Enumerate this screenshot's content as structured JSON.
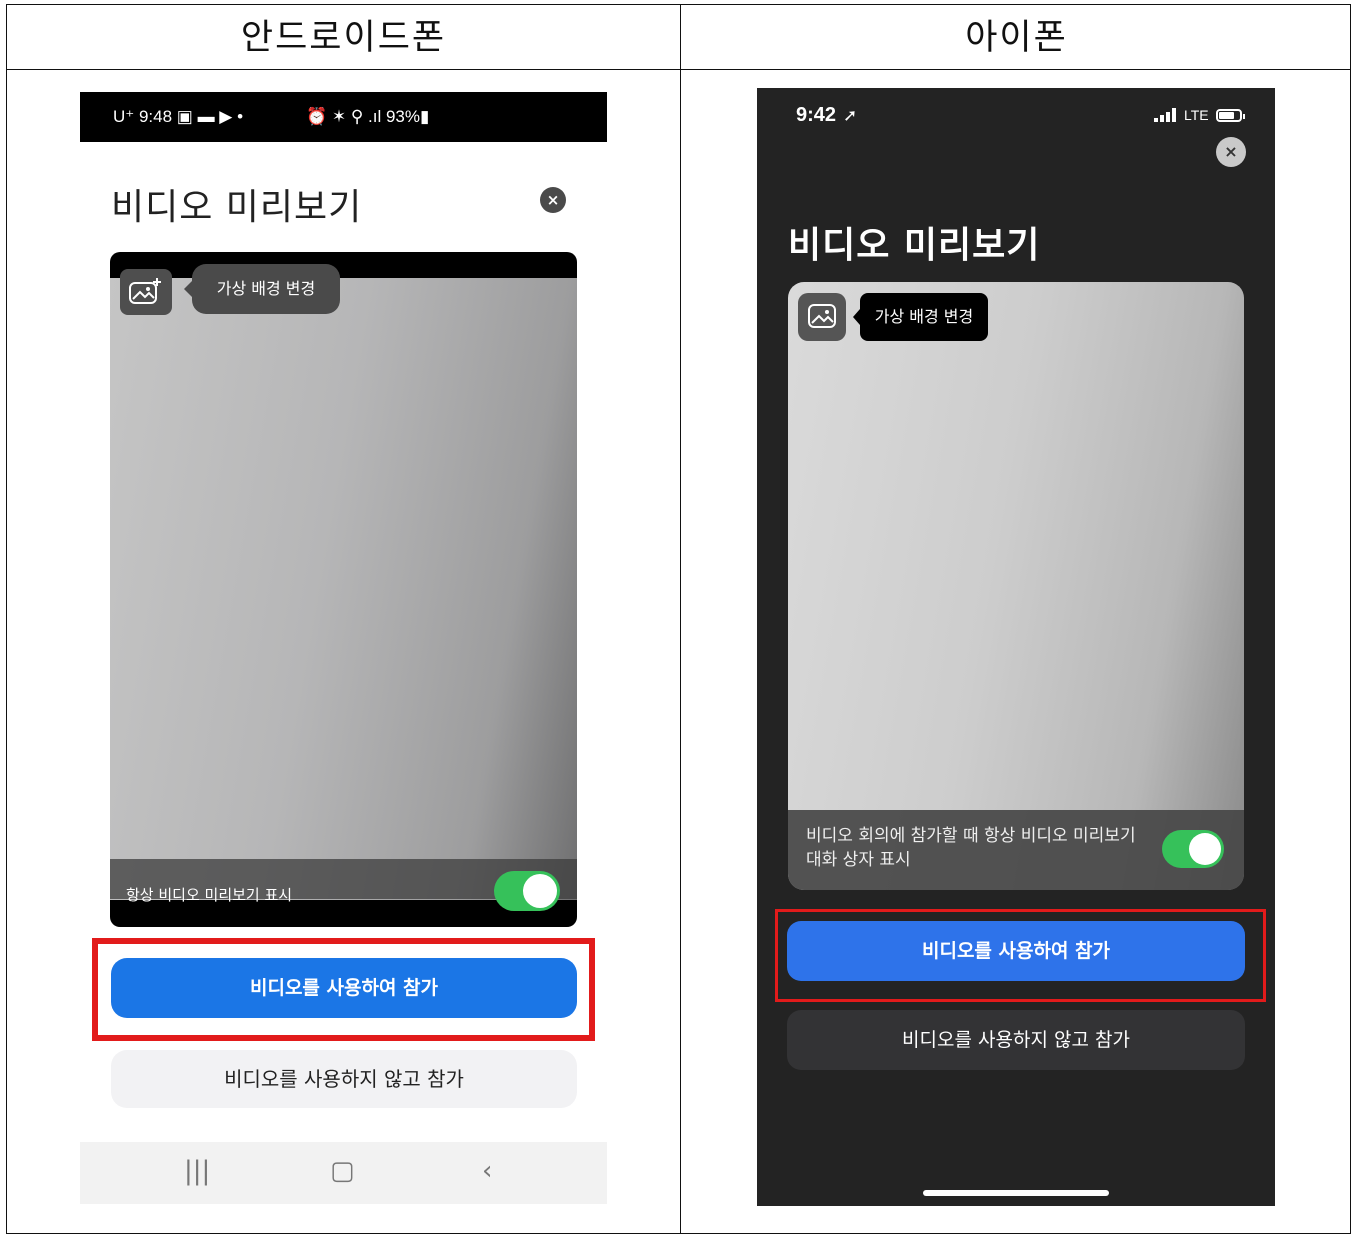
{
  "table": {
    "header_left": "안드로이드폰",
    "header_right": "아이폰"
  },
  "android": {
    "status_left": "U⁺ 9:48 ▣ ▬ ▶ •",
    "status_right": "⏰ ✶ ⚲ .ıl 93%▮",
    "title": "비디오 미리보기",
    "close_icon": "×",
    "virtual_bg_tooltip": "가상 배경 변경",
    "always_show_label": "항상 비디오 미리보기 표시",
    "toggle_on": true,
    "join_with_video": "비디오를 사용하여 참가",
    "join_without_video": "비디오를 사용하지 않고 참가",
    "nav_recent": "|||",
    "nav_home": "▢",
    "nav_back": "‹",
    "accent_color": "#1b76e6",
    "highlight_color": "#e21b1b"
  },
  "iphone": {
    "time": "9:42",
    "location_icon": "➚",
    "network": "LTE",
    "close_icon": "×",
    "title": "비디오 미리보기",
    "virtual_bg_tooltip": "가상 배경 변경",
    "always_show_label": "비디오 회의에 참가할 때 항상 비디오 미리보기 대화 상자 표시",
    "toggle_on": true,
    "join_with_video": "비디오를 사용하여 참가",
    "join_without_video": "비디오를 사용하지 않고 참가",
    "accent_color": "#2e73ea",
    "highlight_color": "#e21b1b"
  }
}
